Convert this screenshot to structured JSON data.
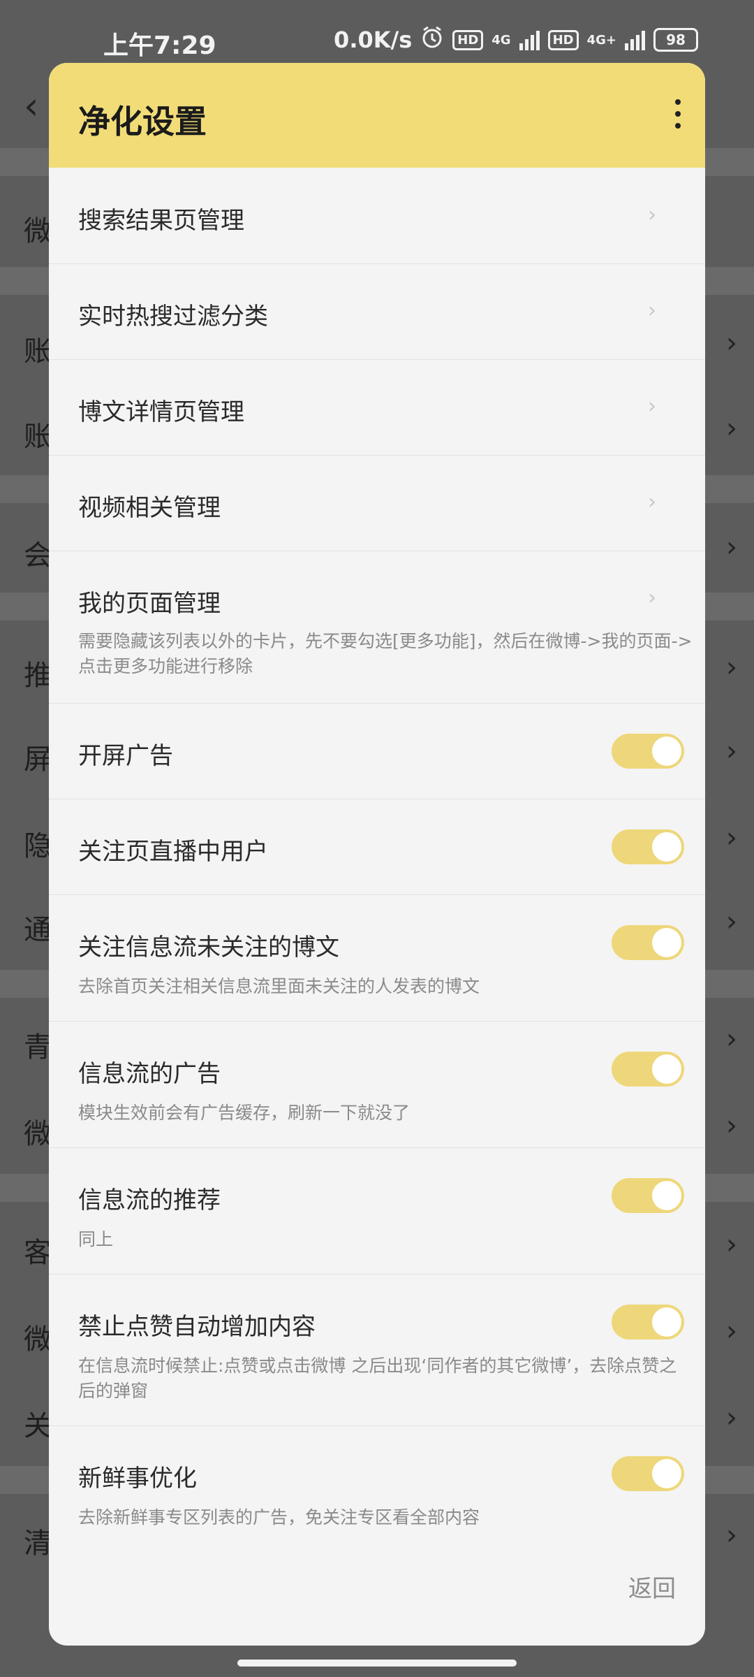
{
  "status_bar": {
    "time": "上午7:29",
    "speed": "0.0K/s",
    "sim1_tag": "HD",
    "sim1_net": "4G",
    "sim2_tag": "HD",
    "sim2_net": "4G+",
    "battery": "98",
    "alarm_icon": "alarm-icon"
  },
  "background": {
    "row_labels": [
      "微",
      "账",
      "账",
      "会",
      "推",
      "屏",
      "隐",
      "通",
      "青",
      "微",
      "客",
      "微",
      "关",
      "清"
    ],
    "chevron": "›",
    "back_icon": "‹"
  },
  "dialog": {
    "title": "净化设置",
    "menu_icon": "more-vertical-icon",
    "items": [
      {
        "label": "搜索结果页管理",
        "chevron": "›"
      },
      {
        "label": "实时热搜过滤分类",
        "chevron": "›"
      },
      {
        "label": "博文详情页管理",
        "chevron": "›"
      },
      {
        "label": "视频相关管理",
        "chevron": "›"
      },
      {
        "label": "我的页面管理",
        "chevron": "›",
        "sub": "需要隐藏该列表以外的卡片，先不要勾选[更多功能]，然后在微博->我的页面->点击更多功能进行移除"
      },
      {
        "label": "开屏广告",
        "toggle": true
      },
      {
        "label": "关注页直播中用户",
        "toggle": true
      },
      {
        "label": "关注信息流未关注的博文",
        "toggle": true,
        "sub": "去除首页关注相关信息流里面未关注的人发表的博文"
      },
      {
        "label": "信息流的广告",
        "toggle": true,
        "sub": "模块生效前会有广告缓存，刷新一下就没了"
      },
      {
        "label": "信息流的推荐",
        "toggle": true,
        "sub": "同上"
      },
      {
        "label": "禁止点赞自动增加内容",
        "toggle": true,
        "sub": "在信息流时候禁止:点赞或点击微博 之后出现‘同作者的其它微博’，去除点赞之后的弹窗"
      },
      {
        "label": "新鲜事优化",
        "toggle": true,
        "sub": "去除新鲜事专区列表的广告，免关注专区看全部内容"
      }
    ],
    "back_label": "返回"
  }
}
